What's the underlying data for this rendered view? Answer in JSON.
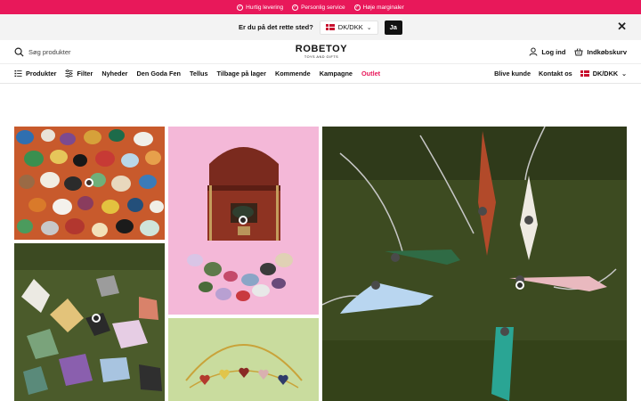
{
  "topbar": {
    "usps": [
      "Hurtig levering",
      "Personlig service",
      "Høje marginaler"
    ]
  },
  "country_prompt": {
    "question": "Er du på det rette sted?",
    "selected": "DK/DKK",
    "confirm_label": "Ja"
  },
  "header": {
    "search_placeholder": "Søg produkter",
    "logo_name": "ROBETOY",
    "logo_tagline": "TOYS AND GIFTS",
    "login_label": "Log ind",
    "cart_label": "Indkøbskurv"
  },
  "nav": {
    "products_label": "Produkter",
    "filter_label": "Filter",
    "items": [
      "Nyheder",
      "Den Goda Fen",
      "Tellus",
      "Tilbage på lager",
      "Kommende",
      "Kampagne"
    ],
    "outlet_label": "Outlet",
    "become_customer": "Blive kunde",
    "contact": "Kontakt os",
    "currency": "DK/DKK"
  },
  "colors": {
    "accent": "#e8185a",
    "topbar_bg": "#e8185a",
    "country_bar_bg": "#f3f3f3"
  },
  "gallery": {
    "tiles": [
      "tumbled-stones-orange",
      "treasure-chest-pink",
      "crystal-pendants-moss",
      "raw-crystals-moss",
      "heart-bracelet-green"
    ]
  }
}
